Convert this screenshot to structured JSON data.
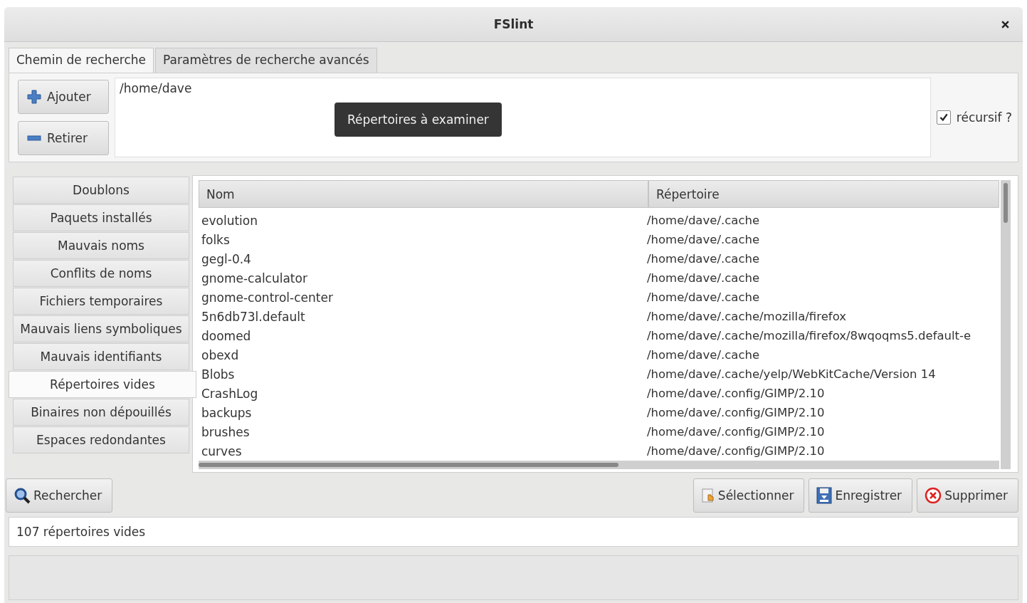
{
  "window": {
    "title": "FSlint"
  },
  "tabs": [
    {
      "label": "Chemin de recherche",
      "selected": true
    },
    {
      "label": "Paramètres de recherche avancés",
      "selected": false
    }
  ],
  "path_buttons": [
    {
      "label": "Ajouter",
      "kind": "add"
    },
    {
      "label": "Retirer",
      "kind": "remove"
    }
  ],
  "paths": [
    "/home/dave"
  ],
  "tooltip": "Répertoires à examiner",
  "recursive": {
    "label": "récursif ?",
    "checked": true
  },
  "sidebar": {
    "items": [
      {
        "label": "Doublons",
        "selected": false
      },
      {
        "label": "Paquets installés",
        "selected": false
      },
      {
        "label": "Mauvais noms",
        "selected": false
      },
      {
        "label": "Conflits de noms",
        "selected": false
      },
      {
        "label": "Fichiers temporaires",
        "selected": false
      },
      {
        "label": "Mauvais liens symboliques",
        "selected": false
      },
      {
        "label": "Mauvais identifiants",
        "selected": false
      },
      {
        "label": "Répertoires vides",
        "selected": true
      },
      {
        "label": "Binaires non dépouillés",
        "selected": false
      },
      {
        "label": "Espaces redondantes",
        "selected": false
      }
    ]
  },
  "table": {
    "columns": [
      "Nom",
      "Répertoire"
    ],
    "rows": [
      [
        "evolution",
        "/home/dave/.cache"
      ],
      [
        "folks",
        "/home/dave/.cache"
      ],
      [
        "gegl-0.4",
        "/home/dave/.cache"
      ],
      [
        "gnome-calculator",
        "/home/dave/.cache"
      ],
      [
        "gnome-control-center",
        "/home/dave/.cache"
      ],
      [
        "5n6db73l.default",
        "/home/dave/.cache/mozilla/firefox"
      ],
      [
        "doomed",
        "/home/dave/.cache/mozilla/firefox/8wqoqms5.default-e"
      ],
      [
        "obexd",
        "/home/dave/.cache"
      ],
      [
        "Blobs",
        "/home/dave/.cache/yelp/WebKitCache/Version 14"
      ],
      [
        "CrashLog",
        "/home/dave/.config/GIMP/2.10"
      ],
      [
        "backups",
        "/home/dave/.config/GIMP/2.10"
      ],
      [
        "brushes",
        "/home/dave/.config/GIMP/2.10"
      ],
      [
        "curves",
        "/home/dave/.config/GIMP/2.10"
      ]
    ]
  },
  "search_button": "Rechercher",
  "action_buttons": [
    {
      "label": "Sélectionner",
      "kind": "select"
    },
    {
      "label": "Enregistrer",
      "kind": "save"
    },
    {
      "label": "Supprimer",
      "kind": "delete"
    }
  ],
  "status": "107 répertoires vides"
}
